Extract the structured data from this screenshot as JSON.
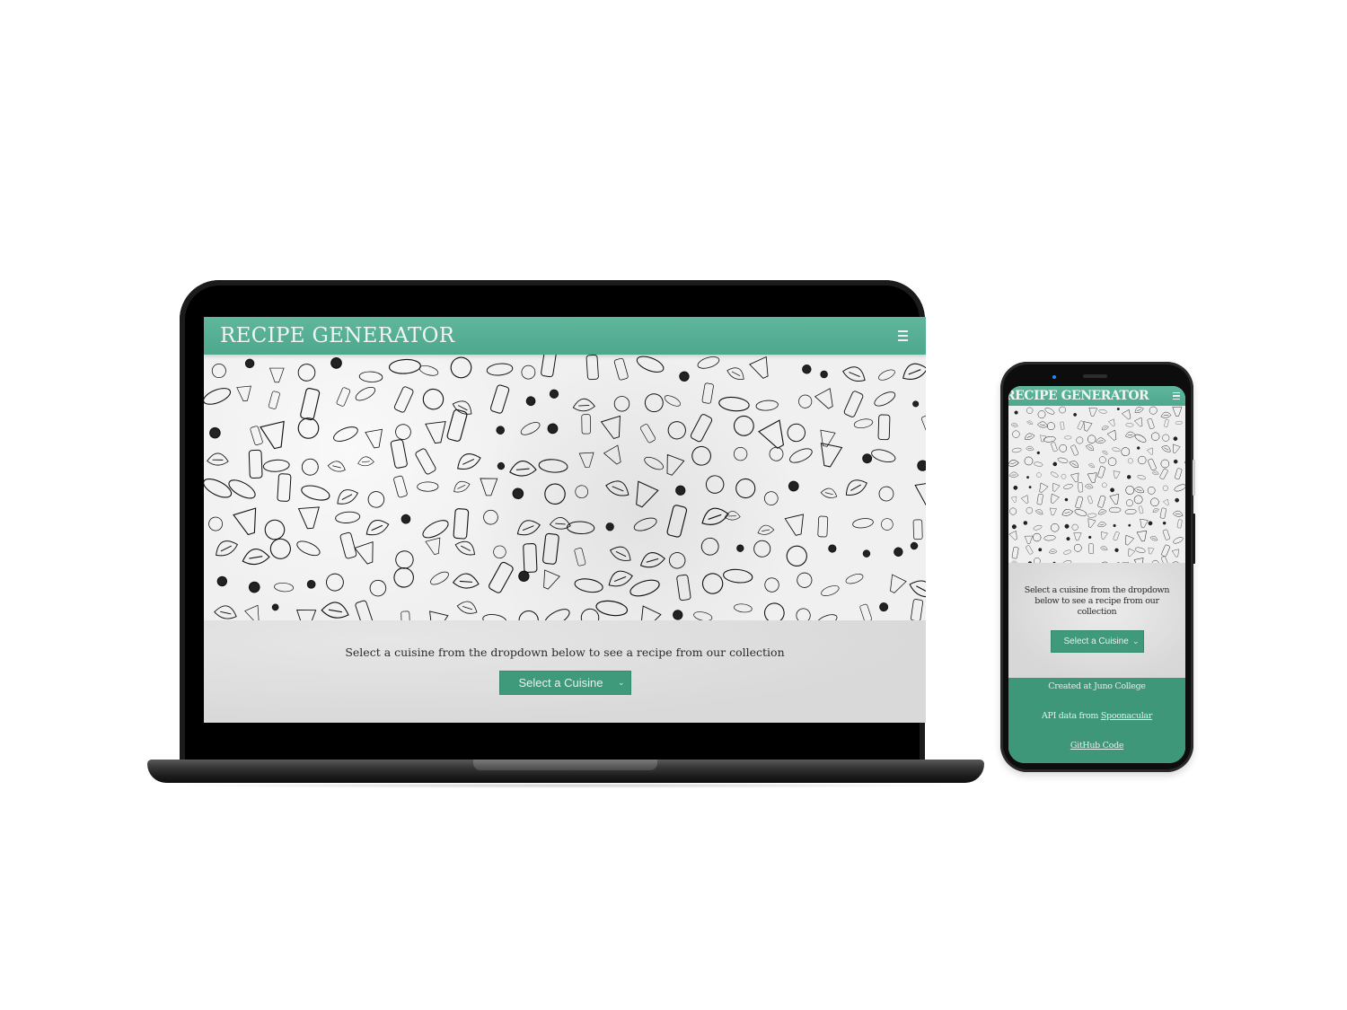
{
  "colors": {
    "header_green": "#5fb69c",
    "button_green": "#3e9a7b",
    "footer_green": "#3f977a",
    "page_gray": "#dcdcdc",
    "device_black": "#000000"
  },
  "desktop": {
    "header": {
      "title": "RECIPE GENERATOR",
      "menu_icon": "hamburger-menu-icon"
    },
    "hero": {
      "image": "food-doodles-illustration"
    },
    "main": {
      "prompt": "Select a cuisine from the dropdown below to see a recipe from our collection",
      "select": {
        "selected": "Select a Cuisine",
        "icon": "chevron-down-icon"
      }
    }
  },
  "mobile": {
    "header": {
      "title": "RECIPE GENERATOR",
      "menu_icon": "hamburger-menu-icon"
    },
    "hero": {
      "image": "food-doodles-illustration"
    },
    "main": {
      "prompt": "Select a cuisine from the dropdown below to see a recipe from our collection",
      "select": {
        "selected": "Select a Cuisine",
        "icon": "chevron-down-icon"
      }
    },
    "footer": {
      "created": "Created at Juno College",
      "api_prefix": "API data from ",
      "api_link": "Spoonacular",
      "github_link": "GitHub Code"
    }
  }
}
